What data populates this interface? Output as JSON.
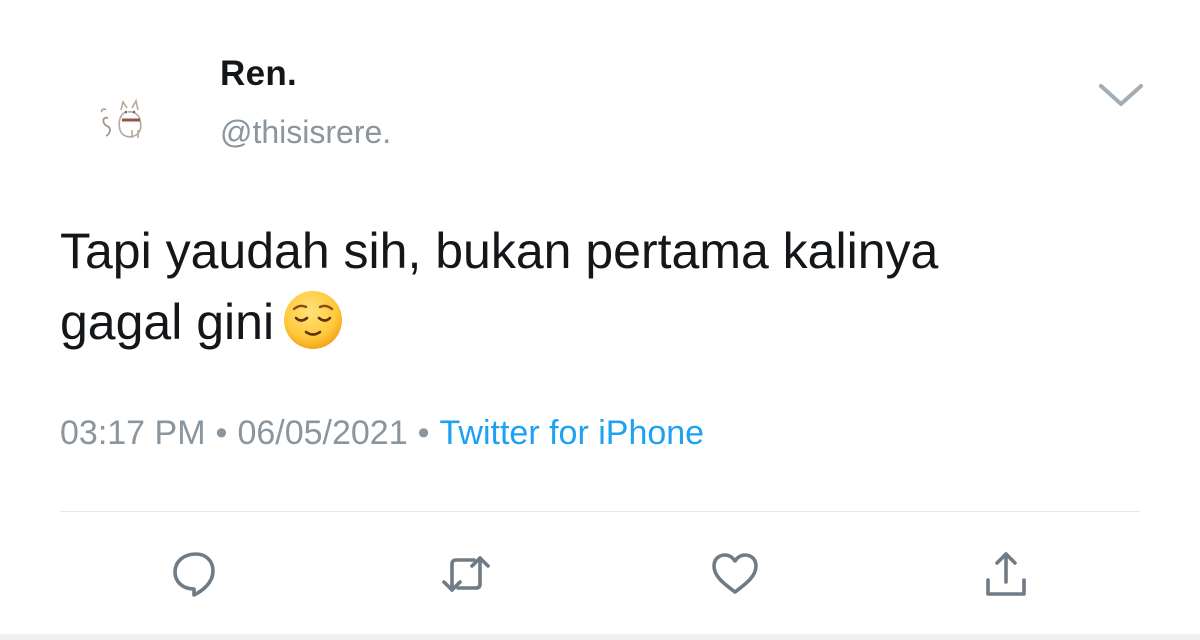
{
  "tweet": {
    "author": {
      "display_name": "Ren.",
      "handle": "@thisisrere.",
      "avatar_icon": "cat-doodle-icon"
    },
    "text_line1": "Tapi yaudah sih, bukan pertama kalinya",
    "text_line2": "gagal gini",
    "emoji": "relieved-face-emoji",
    "meta": {
      "time": "03:17 PM",
      "separator": "•",
      "date": "06/05/2021",
      "source": "Twitter for iPhone"
    },
    "actions": [
      {
        "name": "reply",
        "icon": "speech-bubble-icon"
      },
      {
        "name": "retweet",
        "icon": "retweet-arrows-icon"
      },
      {
        "name": "like",
        "icon": "heart-icon"
      },
      {
        "name": "share",
        "icon": "share-upload-icon"
      }
    ]
  },
  "colors": {
    "text": "#14171a",
    "secondary": "#8a959e",
    "link": "#1da1f2",
    "icon": "#6f7b86",
    "divider": "#e1e8ed"
  }
}
